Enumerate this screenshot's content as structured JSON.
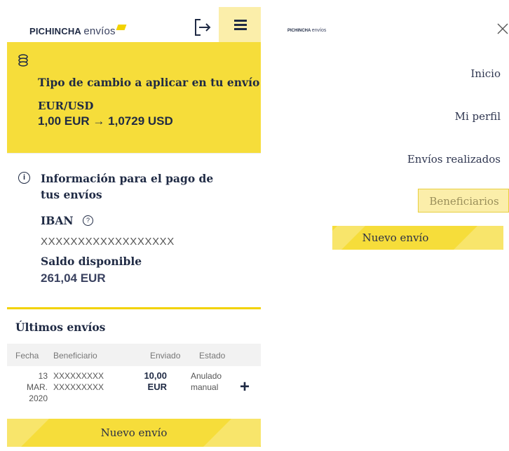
{
  "left": {
    "logo": {
      "brand": "PICHINCHA",
      "sub": "envíos"
    },
    "rate": {
      "title": "Tipo de cambio a aplicar en tu envío",
      "pair": "EUR/USD",
      "value": "1,00 EUR → 1,0729 USD"
    },
    "info": {
      "title": "Información para el pago de tus envíos",
      "iban_label": "IBAN",
      "iban_value": "XXXXXXXXXXXXXXXXXX",
      "saldo_label": "Saldo disponible",
      "saldo_value": "261,04 EUR"
    },
    "ultimos": {
      "title": "Últimos envíos",
      "headers": [
        "Fecha",
        "Beneficiario",
        "Enviado",
        "Estado"
      ],
      "rows": [
        {
          "fecha1": "13 MAR.",
          "fecha2": "2020",
          "benef1": "XXXXXXXXX",
          "benef2": "XXXXXXXXX",
          "enviado1": "10,00",
          "enviado2": "EUR",
          "estado1": "Anulado",
          "estado2": "manual"
        }
      ]
    },
    "nuevo_envio": "Nuevo envío"
  },
  "right": {
    "logo": {
      "brand": "PICHINCHA",
      "sub": "envíos"
    },
    "menu": [
      "Inicio",
      "Mi perfil",
      "Envíos realizados"
    ],
    "beneficiarios": "Beneficiarios",
    "nuevo_envio": "Nuevo envío"
  },
  "colors": {
    "accent": "#f6dd3a",
    "accent_light": "#fbeeaa",
    "text": "#1f2a44"
  },
  "icons": [
    "coins-icon",
    "logout-icon",
    "menu-icon",
    "info-icon",
    "help-icon",
    "plus-icon",
    "close-icon"
  ]
}
